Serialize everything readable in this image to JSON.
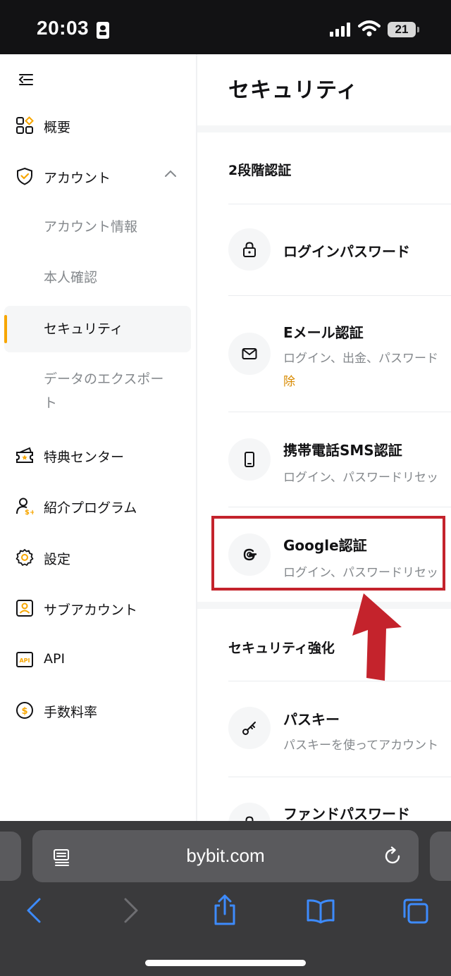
{
  "status_bar": {
    "time": "20:03",
    "battery": "21"
  },
  "sidebar": {
    "items": [
      {
        "label": "概要",
        "icon": "grid-icon"
      },
      {
        "label": "アカウント",
        "icon": "shield-check-icon"
      },
      {
        "label": "特典センター",
        "icon": "ticket-icon"
      },
      {
        "label": "紹介プログラム",
        "icon": "user-plus-icon"
      },
      {
        "label": "設定",
        "icon": "gear-icon"
      },
      {
        "label": "サブアカウント",
        "icon": "id-card-icon"
      },
      {
        "label": "API",
        "icon": "api-icon"
      },
      {
        "label": "手数料率",
        "icon": "dollar-coin-icon"
      }
    ],
    "account_sub": {
      "info": "アカウント情報",
      "verify": "本人確認",
      "security": "セキュリティ",
      "export_line1": "データのエクスポー",
      "export_line2": "ト"
    }
  },
  "main": {
    "title": "セキュリティ",
    "section_2fa": "2段階認証",
    "rows": {
      "login_password": {
        "title": "ログインパスワード"
      },
      "email": {
        "title": "Eメール認証",
        "desc": "ログイン、出金、パスワード",
        "extra": "除"
      },
      "sms": {
        "title": "携帯電話SMS認証",
        "desc": "ログイン、パスワードリセッ"
      },
      "google": {
        "title": "Google認証",
        "desc": "ログイン、パスワードリセッ"
      },
      "passkey": {
        "title": "パスキー",
        "desc": "パスキーを使ってアカウント"
      },
      "fund_password": {
        "title": "ファンドパスワード"
      }
    },
    "section_enhance": "セキュリティ強化"
  },
  "browser": {
    "url": "bybit.com"
  },
  "colors": {
    "accent": "#f7a600",
    "highlight": "#c4232c",
    "ios_blue": "#3d8bfd"
  }
}
